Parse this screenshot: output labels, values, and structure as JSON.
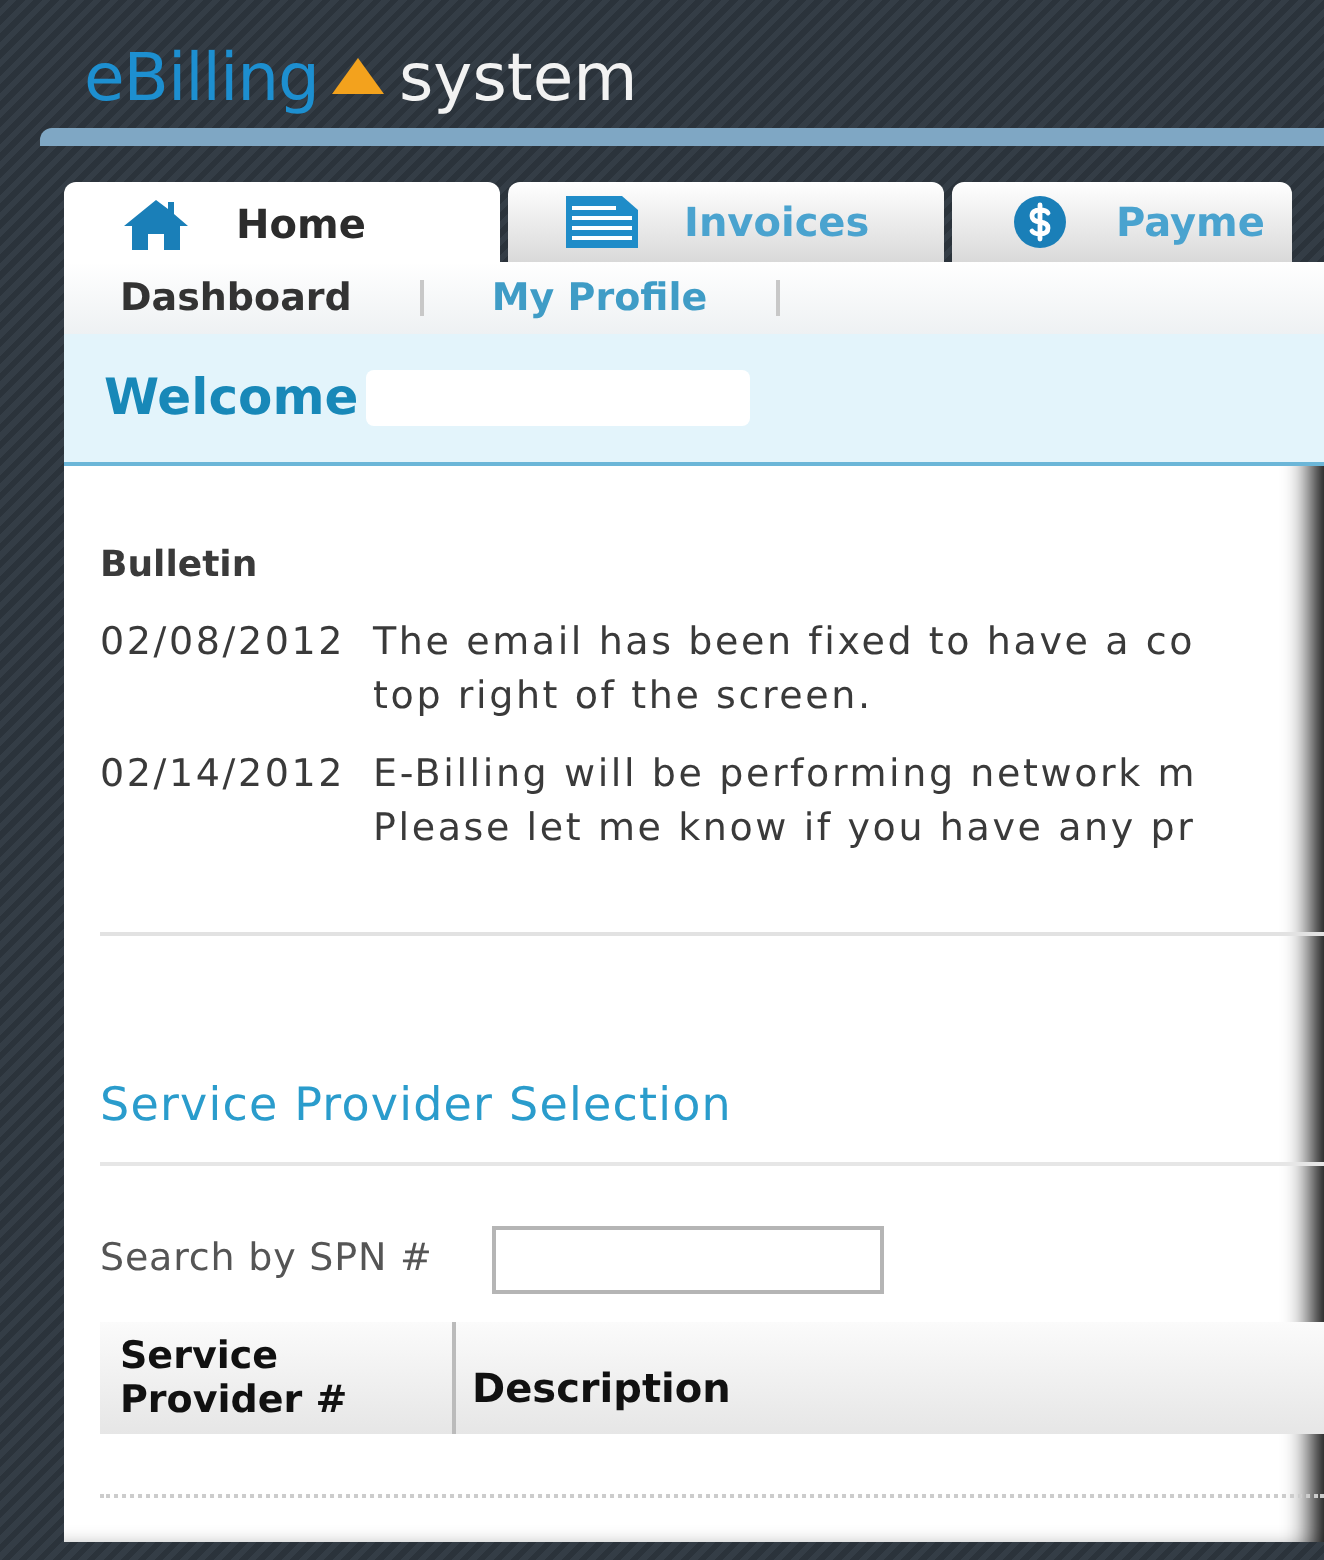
{
  "logo": {
    "brand": "eBilling",
    "product": "system"
  },
  "tabs": [
    {
      "label": "Home",
      "selected": true
    },
    {
      "label": "Invoices",
      "selected": false
    },
    {
      "label": "Payme",
      "selected": false
    }
  ],
  "subnav": [
    {
      "label": "Dashboard",
      "selected": true
    },
    {
      "label": "My Profile",
      "selected": false
    }
  ],
  "welcome": {
    "title": "Welcome"
  },
  "bulletin": {
    "title": "Bulletin",
    "items": [
      {
        "date": "02/08/2012",
        "lines": [
          "The email has been fixed to have a co",
          "top right of the screen."
        ]
      },
      {
        "date": "02/14/2012",
        "lines": [
          "E-Billing will be performing network m",
          "Please let me know if you have any pr"
        ]
      }
    ]
  },
  "service_provider": {
    "title": "Service Provider Selection",
    "search_label": "Search by SPN #",
    "table": {
      "columns": [
        "Service Provider #",
        "Description"
      ]
    }
  }
}
